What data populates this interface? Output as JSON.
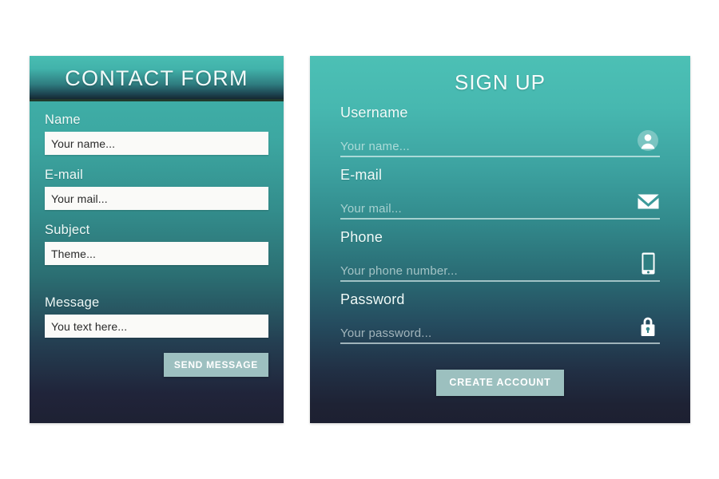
{
  "contact_form": {
    "title": "CONTACT FORM",
    "fields": [
      {
        "label": "Name",
        "placeholder": "Your name..."
      },
      {
        "label": "E-mail",
        "placeholder": "Your mail..."
      },
      {
        "label": "Subject",
        "placeholder": "Theme..."
      },
      {
        "label": "Message",
        "placeholder": "You text here..."
      }
    ],
    "submit_label": "SEND MESSAGE"
  },
  "sign_up": {
    "title": "SIGN UP",
    "fields": [
      {
        "label": "Username",
        "placeholder": "Your name...",
        "icon": "user-avatar-icon"
      },
      {
        "label": "E-mail",
        "placeholder": "Your mail...",
        "icon": "envelope-icon"
      },
      {
        "label": "Phone",
        "placeholder": "Your phone number...",
        "icon": "smartphone-icon"
      },
      {
        "label": "Password",
        "placeholder": "Your password...",
        "icon": "lock-icon"
      }
    ],
    "submit_label": "CREATE ACCOUNT"
  },
  "colors": {
    "gradient_top": "#4cc0b5",
    "gradient_bottom": "#1d2031",
    "button": "#9dc0c0",
    "button_text": "#ffffff",
    "input_background": "#fafaf8",
    "input_text": "#2a2a2a",
    "page_background": "#ffffff"
  }
}
